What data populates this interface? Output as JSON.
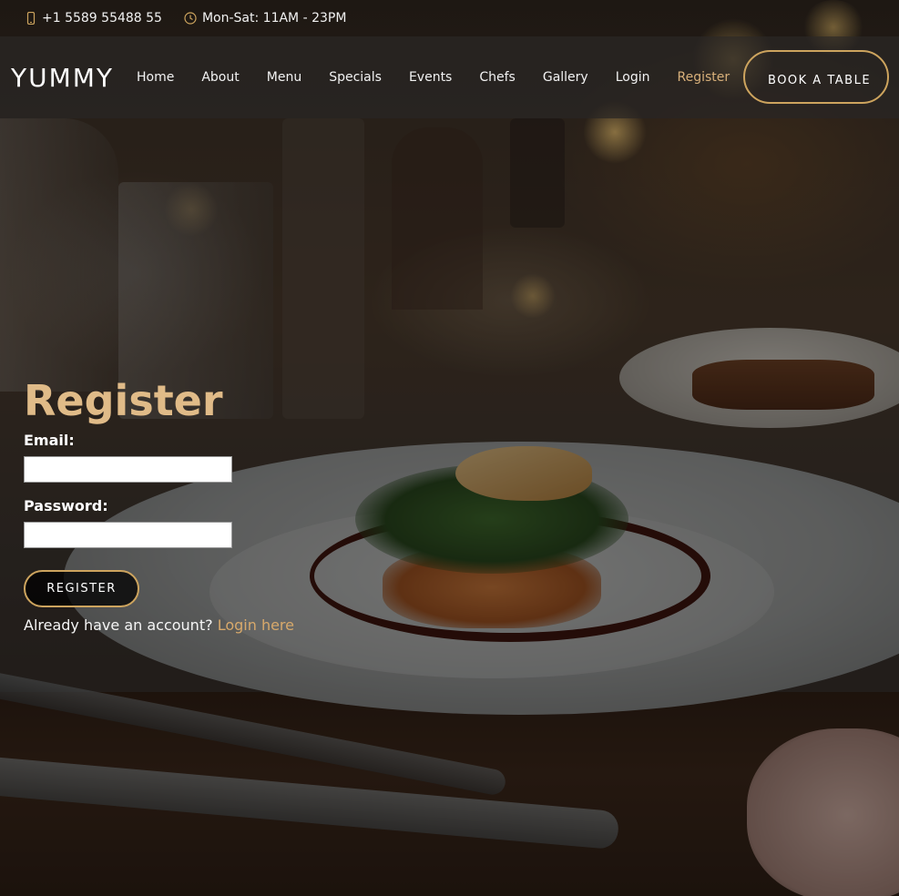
{
  "topbar": {
    "phone": "+1 5589 55488 55",
    "hours": "Mon-Sat: 11AM - 23PM",
    "phone_icon": "mobile-phone-icon",
    "clock_icon": "clock-icon"
  },
  "header": {
    "logo": "YUMMY",
    "nav": [
      {
        "label": "Home"
      },
      {
        "label": "About"
      },
      {
        "label": "Menu"
      },
      {
        "label": "Specials"
      },
      {
        "label": "Events"
      },
      {
        "label": "Chefs"
      },
      {
        "label": "Gallery"
      },
      {
        "label": "Login"
      },
      {
        "label": "Register",
        "active": true
      }
    ],
    "book_button": "Book a Table"
  },
  "form": {
    "title": "Register",
    "email_label": "Email:",
    "email_value": "",
    "password_label": "Password:",
    "password_value": "",
    "submit_label": "Register",
    "account_prompt": "Already have an account?",
    "login_link": "Login here"
  },
  "colors": {
    "accent": "#cda45e",
    "title": "#e0bb88",
    "active_nav": "#d8b07a",
    "link": "#d8a96b"
  }
}
